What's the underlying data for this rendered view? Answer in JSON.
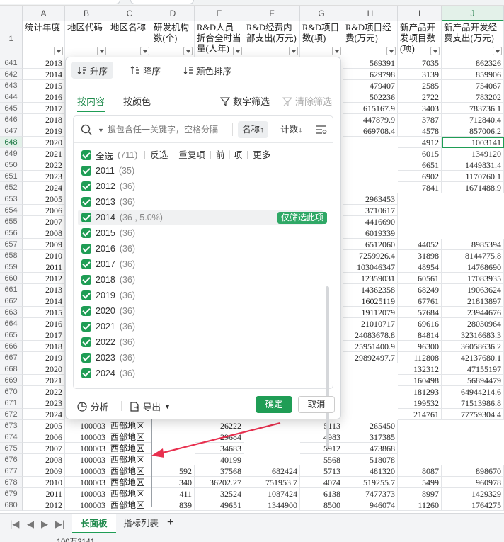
{
  "columns": [
    "A",
    "B",
    "C",
    "D",
    "E",
    "F",
    "G",
    "H",
    "I",
    "J"
  ],
  "headers": [
    "统计年度",
    "地区代码",
    "地区名称",
    "研发机构数(个)",
    "R&D人员折合全时当量(人年)",
    "R&D经费内部支出(万元)",
    "R&D项目数(项)",
    "R&D项目经费(万元)",
    "新产品开发项目数(项)",
    "新产品开发经费支出(万元)"
  ],
  "header_row_number": "1",
  "active_row": "648",
  "active_cell_value": "1003141",
  "rows": [
    {
      "n": "641",
      "A": "2013",
      "H": "569391",
      "I": "7035",
      "J": "862326"
    },
    {
      "n": "642",
      "A": "2014",
      "H": "629798",
      "I": "3139",
      "J": "859906"
    },
    {
      "n": "643",
      "A": "2015",
      "H": "479407",
      "I": "2585",
      "J": "754067"
    },
    {
      "n": "644",
      "A": "2016",
      "H": "502236",
      "I": "2722",
      "J": "783202"
    },
    {
      "n": "645",
      "A": "2017",
      "H": "615167.9",
      "I": "3403",
      "J": "783736.1"
    },
    {
      "n": "646",
      "A": "2018",
      "H": "447879.9",
      "I": "3787",
      "J": "712840.4"
    },
    {
      "n": "647",
      "A": "2019",
      "H": "669708.4",
      "I": "4578",
      "J": "857006.2"
    },
    {
      "n": "648",
      "A": "2020",
      "I": "4912",
      "J": "1003141"
    },
    {
      "n": "649",
      "A": "2021",
      "I": "6015",
      "J": "1349120"
    },
    {
      "n": "650",
      "A": "2022",
      "I": "6651",
      "J": "1449831.4"
    },
    {
      "n": "651",
      "A": "2023",
      "I": "6902",
      "J": "1170760.1"
    },
    {
      "n": "652",
      "A": "2024",
      "I": "7841",
      "J": "1671488.9"
    },
    {
      "n": "653",
      "A": "2005",
      "H": "2963453"
    },
    {
      "n": "654",
      "A": "2006",
      "H": "3710617"
    },
    {
      "n": "655",
      "A": "2007",
      "H": "4416690"
    },
    {
      "n": "656",
      "A": "2008",
      "H": "6019339"
    },
    {
      "n": "657",
      "A": "2009",
      "H": "6512060",
      "I": "44052",
      "J": "8985394"
    },
    {
      "n": "658",
      "A": "2010",
      "H": "7259926.4",
      "I": "31898",
      "J": "8144775.8"
    },
    {
      "n": "659",
      "A": "2011",
      "H": "103046347",
      "I": "48954",
      "J": "14768690"
    },
    {
      "n": "660",
      "A": "2012",
      "H": "12359031",
      "I": "60561",
      "J": "17083935"
    },
    {
      "n": "661",
      "A": "2013",
      "H": "14362358",
      "I": "68249",
      "J": "19063624"
    },
    {
      "n": "662",
      "A": "2014",
      "H": "16025119",
      "I": "67761",
      "J": "21813897"
    },
    {
      "n": "663",
      "A": "2015",
      "H": "19112079",
      "I": "57684",
      "J": "23944676"
    },
    {
      "n": "664",
      "A": "2016",
      "H": "21010717",
      "I": "69616",
      "J": "28030964"
    },
    {
      "n": "665",
      "A": "2017",
      "H": "24083678.8",
      "I": "84814",
      "J": "32316683.3"
    },
    {
      "n": "666",
      "A": "2018",
      "H": "25951400.9",
      "I": "96300",
      "J": "36058636.2"
    },
    {
      "n": "667",
      "A": "2019",
      "H": "29892497.7",
      "I": "112808",
      "J": "42137680.1"
    },
    {
      "n": "668",
      "A": "2020",
      "I": "132312",
      "J": "47155197"
    },
    {
      "n": "669",
      "A": "2021",
      "I": "160498",
      "J": "56894479"
    },
    {
      "n": "670",
      "A": "2022",
      "I": "181293",
      "J": "64944214.6"
    },
    {
      "n": "671",
      "A": "2023",
      "I": "199532",
      "J": "71513986.8"
    },
    {
      "n": "672",
      "A": "2024",
      "I": "214761",
      "J": "77759304.4"
    },
    {
      "n": "673",
      "A": "2005",
      "B": "100003",
      "C": "西部地区",
      "E": "26222",
      "G": "5113",
      "H": "265450"
    },
    {
      "n": "674",
      "A": "2006",
      "B": "100003",
      "C": "西部地区",
      "E": "29684",
      "G": "4983",
      "H": "317385"
    },
    {
      "n": "675",
      "A": "2007",
      "B": "100003",
      "C": "西部地区",
      "E": "34683",
      "G": "5912",
      "H": "473868"
    },
    {
      "n": "676",
      "A": "2008",
      "B": "100003",
      "C": "西部地区",
      "E": "40199",
      "G": "5568",
      "H": "518078"
    },
    {
      "n": "677",
      "A": "2009",
      "B": "100003",
      "C": "西部地区",
      "D": "592",
      "E": "37568",
      "F": "682424",
      "G": "5713",
      "H": "481320",
      "I": "8087",
      "J": "898670"
    },
    {
      "n": "678",
      "A": "2010",
      "B": "100003",
      "C": "西部地区",
      "D": "340",
      "E": "36202.27",
      "F": "751953.7",
      "G": "4074",
      "H": "519255.7",
      "I": "5499",
      "J": "960978"
    },
    {
      "n": "679",
      "A": "2011",
      "B": "100003",
      "C": "西部地区",
      "D": "411",
      "E": "32524",
      "F": "1087424",
      "G": "6138",
      "H": "7477373",
      "I": "8997",
      "J": "1429329"
    },
    {
      "n": "680",
      "A": "2012",
      "B": "100003",
      "C": "西部地区",
      "D": "839",
      "E": "49651",
      "F": "1344900",
      "G": "8500",
      "H": "946074",
      "I": "11260",
      "J": "1764275"
    }
  ],
  "filter": {
    "sort_asc": "升序",
    "sort_desc": "降序",
    "sort_color": "颜色排序",
    "tab_content": "按内容",
    "tab_color": "按颜色",
    "number_filter": "数字筛选",
    "clear_filter": "清除筛选",
    "search_placeholder": "搜包含任一关键字，空格分隔",
    "sort_by_name": "名称↑",
    "sort_by_count": "计数↓",
    "select_all": "全选",
    "select_all_count": "(711)",
    "quick": [
      "反选",
      "重复项",
      "前十项",
      "更多"
    ],
    "items": [
      {
        "label": "2011",
        "count": "(35)"
      },
      {
        "label": "2012",
        "count": "(36)"
      },
      {
        "label": "2013",
        "count": "(36)"
      },
      {
        "label": "2014",
        "count": "(36 , 5.0%)"
      },
      {
        "label": "2015",
        "count": "(36)"
      },
      {
        "label": "2016",
        "count": "(36)"
      },
      {
        "label": "2017",
        "count": "(36)"
      },
      {
        "label": "2018",
        "count": "(36)"
      },
      {
        "label": "2019",
        "count": "(36)"
      },
      {
        "label": "2020",
        "count": "(36)"
      },
      {
        "label": "2021",
        "count": "(36)"
      },
      {
        "label": "2022",
        "count": "(36)"
      },
      {
        "label": "2023",
        "count": "(36)"
      },
      {
        "label": "2024",
        "count": "(36)"
      }
    ],
    "only_this": "仅筛选此项",
    "analyze": "分析",
    "export": "导出",
    "ok": "确定",
    "cancel": "取消"
  },
  "sheet_tabs": [
    "长面板",
    "指标列表"
  ],
  "status_text": "100万3141",
  "colors": {
    "accent": "#1f9d55",
    "arrow": "#e8304f"
  }
}
